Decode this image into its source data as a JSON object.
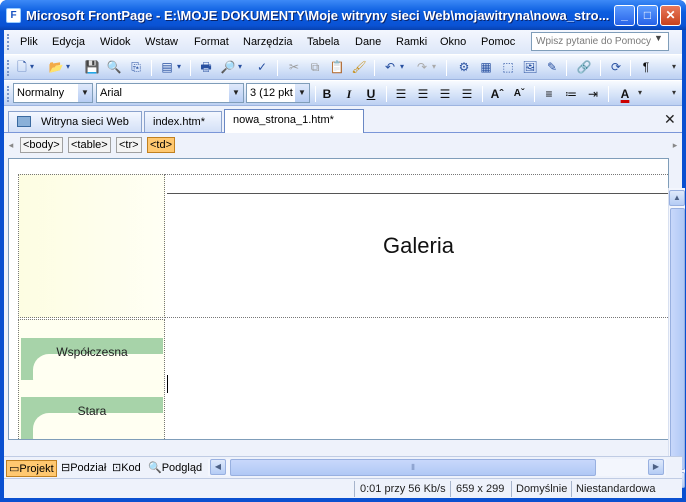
{
  "window": {
    "title": "Microsoft FrontPage - E:\\MOJE DOKUMENTY\\Moje witryny sieci Web\\mojawitryna\\nowa_stro...",
    "app_icon": "frontpage-icon",
    "controls": {
      "minimize": "_",
      "maximize": "□",
      "close": "✕"
    }
  },
  "menu": {
    "items": [
      "Plik",
      "Edycja",
      "Widok",
      "Wstaw",
      "Format",
      "Narzędzia",
      "Tabela",
      "Dane",
      "Ramki",
      "Okno",
      "Pomoc"
    ],
    "ask_placeholder": "Wpisz pytanie do Pomocy"
  },
  "toolbar_standard": {
    "icons": [
      "new-page-icon",
      "open-icon",
      "save-icon",
      "search-icon",
      "publish-icon",
      "toggle-pane-icon",
      "print-icon",
      "print-preview-icon",
      "spelling-icon",
      "cut-icon",
      "copy-icon",
      "paste-icon",
      "format-painter-icon",
      "undo-icon",
      "redo-icon",
      "web-component-icon",
      "insert-table-icon",
      "insert-layer-icon",
      "insert-picture-icon",
      "drawing-icon",
      "hyperlink-icon",
      "refresh-icon",
      "show-all-icon"
    ]
  },
  "toolbar_formatting": {
    "style": "Normalny",
    "font": "Arial",
    "size": "3  (12 pkt",
    "bold": "B",
    "italic": "I",
    "underline": "U",
    "font_color": "A",
    "font_color_hex": "#cc0000"
  },
  "tabs": {
    "items": [
      {
        "label": "Witryna sieci Web",
        "icon": "website-icon"
      },
      {
        "label": "index.htm*"
      },
      {
        "label": "nowa_strona_1.htm*"
      }
    ],
    "active_index": 2,
    "close": "✕"
  },
  "tag_selector": {
    "tags": [
      "<body>",
      "<table>",
      "<tr>",
      "<td>"
    ],
    "selected_index": 3
  },
  "page": {
    "heading": "Galeria",
    "nav_buttons": [
      "Współczesna",
      "Stara"
    ],
    "nav_button_color": "#a7d3a9"
  },
  "views": {
    "items": [
      "Projekt",
      "Podział",
      "Kod",
      "Podgląd"
    ],
    "active_index": 0
  },
  "status": {
    "download": "0:01 przy 56 Kb/s",
    "dimensions": "659 x 299",
    "style_mode": "Domyślnie",
    "schema": "Niestandardowa"
  }
}
